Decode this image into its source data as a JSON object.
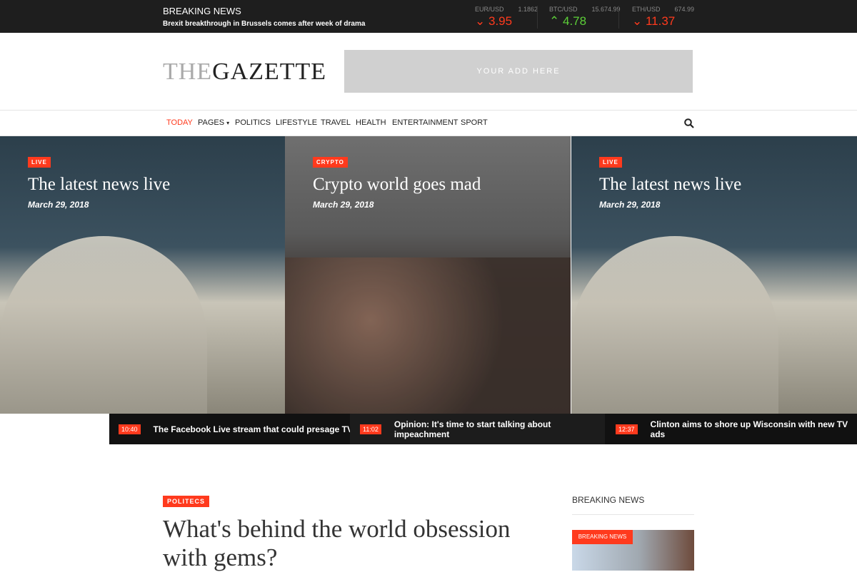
{
  "topbar": {
    "breaking_title": "BREAKING NEWS",
    "breaking_headline": "Brexit breakthrough in Brussels comes after week of drama",
    "tickers": [
      {
        "pair": "EUR/USD",
        "price": "1.1862",
        "change": "3.95",
        "direction": "down"
      },
      {
        "pair": "BTC/USD",
        "price": "15.674.99",
        "change": "4.78",
        "direction": "up"
      },
      {
        "pair": "ETH/USD",
        "price": "674.99",
        "change": "11.37",
        "direction": "down"
      }
    ]
  },
  "header": {
    "logo_light": "THE",
    "logo_dark": "GAZETTE",
    "ad_text": "YOUR ADD HERE"
  },
  "nav": {
    "items": [
      "TODAY",
      "PAGES",
      "POLITICS",
      "LIFESTYLE",
      "TRAVEL",
      "HEALTH",
      "ENTERTAINMENT",
      "SPORT"
    ],
    "active": "TODAY",
    "search_icon": "search-icon"
  },
  "hero": [
    {
      "tag": "LIVE",
      "title": "The latest news live",
      "date": "March 29, 2018"
    },
    {
      "tag": "CRYPTO",
      "title": "Crypto world goes mad",
      "date": "March 29, 2018"
    },
    {
      "tag": "LIVE",
      "title": "The latest news live",
      "date": "March 29, 2018"
    }
  ],
  "strip": [
    {
      "time": "10:40",
      "text": "The Facebook Live stream that could presage TV"
    },
    {
      "time": "11:02",
      "text": "Opinion: It's time to start talking about impeachment"
    },
    {
      "time": "12:37",
      "text": "Clinton aims to shore up Wisconsin with new TV ads"
    }
  ],
  "article": {
    "category": "POLITECS",
    "title": "What's behind the world obsession with gems?"
  },
  "sidebar": {
    "heading": "BREAKING NEWS",
    "card_tag": "BREAKING NEWS"
  },
  "colors": {
    "accent": "#ff3a1d",
    "up": "#5ccf38",
    "topbar": "#1e1e1e"
  }
}
